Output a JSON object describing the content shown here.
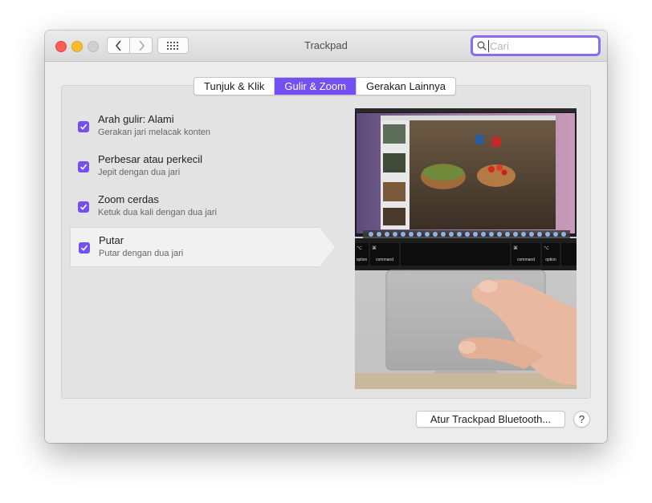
{
  "window": {
    "title": "Trackpad",
    "search_placeholder": "Cari"
  },
  "tabs": [
    {
      "label": "Tunjuk & Klik",
      "active": false
    },
    {
      "label": "Gulir & Zoom",
      "active": true
    },
    {
      "label": "Gerakan Lainnya",
      "active": false
    }
  ],
  "options": [
    {
      "title": "Arah gulir: Alami",
      "subtitle": "Gerakan jari melacak konten",
      "checked": true,
      "selected": false
    },
    {
      "title": "Perbesar atau perkecil",
      "subtitle": "Jepit dengan dua jari",
      "checked": true,
      "selected": false
    },
    {
      "title": "Zoom cerdas",
      "subtitle": "Ketuk dua kali dengan dua jari",
      "checked": true,
      "selected": false
    },
    {
      "title": "Putar",
      "subtitle": "Putar dengan dua jari",
      "checked": true,
      "selected": true
    }
  ],
  "preview": {
    "keys": [
      {
        "label": "option"
      },
      {
        "label": "command"
      },
      {
        "label": "command"
      },
      {
        "label": "option"
      }
    ],
    "key_symbol_cmd": "⌘",
    "key_symbol_alt": "⌥"
  },
  "footer": {
    "bluetooth_button": "Atur Trackpad Bluetooth...",
    "help_button": "?"
  },
  "colors": {
    "accent": "#7350f2",
    "close": "#fd5f57",
    "minimize": "#febc2e",
    "zoom_inactive": "#cfcfcf"
  }
}
